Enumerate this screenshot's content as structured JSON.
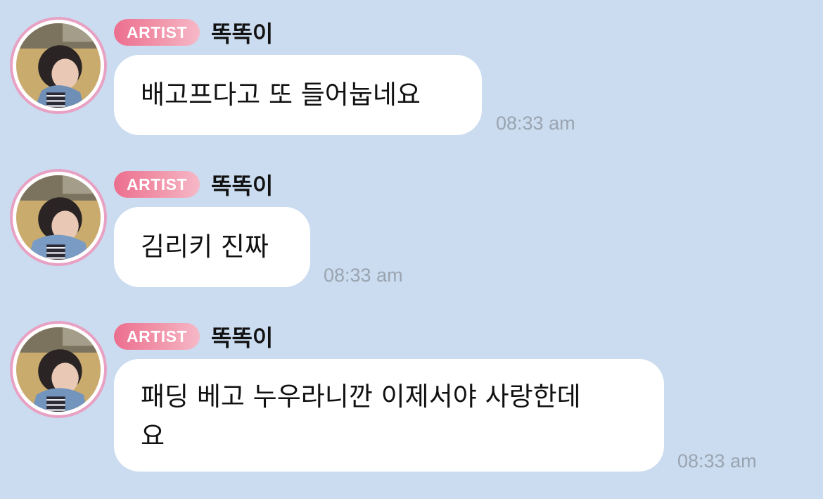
{
  "messages": [
    {
      "badge": "ARTIST",
      "sender": "똑똑이",
      "text": "배고프다고 또 들어눕네요",
      "time": "08:33 am"
    },
    {
      "badge": "ARTIST",
      "sender": "똑똑이",
      "text": "김리키 진짜",
      "time": "08:33 am"
    },
    {
      "badge": "ARTIST",
      "sender": "똑똑이",
      "text_line1": "패딩 베고 누우라니깐 이제서야 사랑한데",
      "text_line2": "요",
      "time": "08:33 am"
    }
  ],
  "colors": {
    "background": "#cbdcf0",
    "bubble": "#ffffff",
    "badge_start": "#ec6f8f",
    "badge_end": "#f6b8c7",
    "avatar_ring": "#e8a1c3",
    "timestamp": "#9aa4b0"
  },
  "icons": {
    "avatar": "profile-photo"
  }
}
